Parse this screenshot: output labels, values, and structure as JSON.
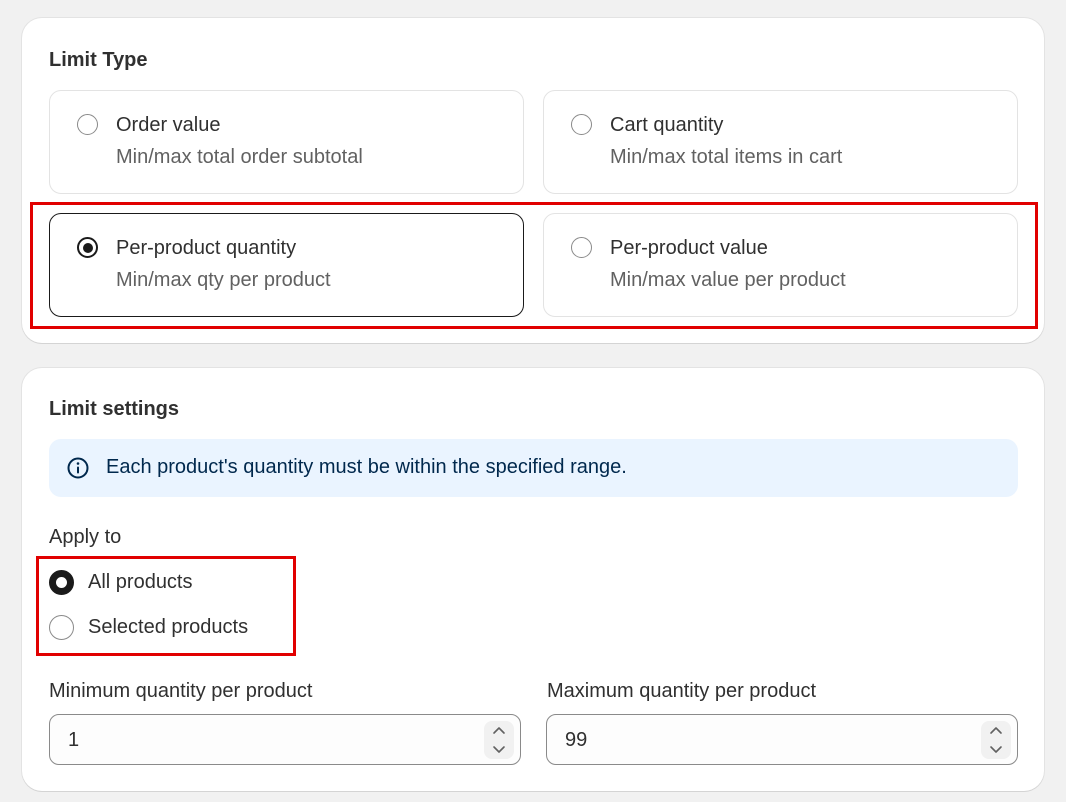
{
  "limit_type": {
    "title": "Limit Type",
    "options": [
      {
        "label": "Order value",
        "description": "Min/max total order subtotal",
        "selected": false
      },
      {
        "label": "Cart quantity",
        "description": "Min/max total items in cart",
        "selected": false
      },
      {
        "label": "Per-product quantity",
        "description": "Min/max qty per product",
        "selected": true
      },
      {
        "label": "Per-product value",
        "description": "Min/max value per product",
        "selected": false
      }
    ]
  },
  "limit_settings": {
    "title": "Limit settings",
    "banner": {
      "icon": "info-icon",
      "text": "Each product's quantity must be within the specified range."
    },
    "apply_to": {
      "label": "Apply to",
      "options": [
        {
          "label": "All products",
          "selected": true
        },
        {
          "label": "Selected products",
          "selected": false
        }
      ]
    },
    "min_quantity": {
      "label": "Minimum quantity per product",
      "value": "1"
    },
    "max_quantity": {
      "label": "Maximum quantity per product",
      "value": "99"
    }
  },
  "colors": {
    "highlight": "#e10000",
    "banner_bg": "#eaf4ff",
    "selected_border": "#1a1a1a"
  }
}
